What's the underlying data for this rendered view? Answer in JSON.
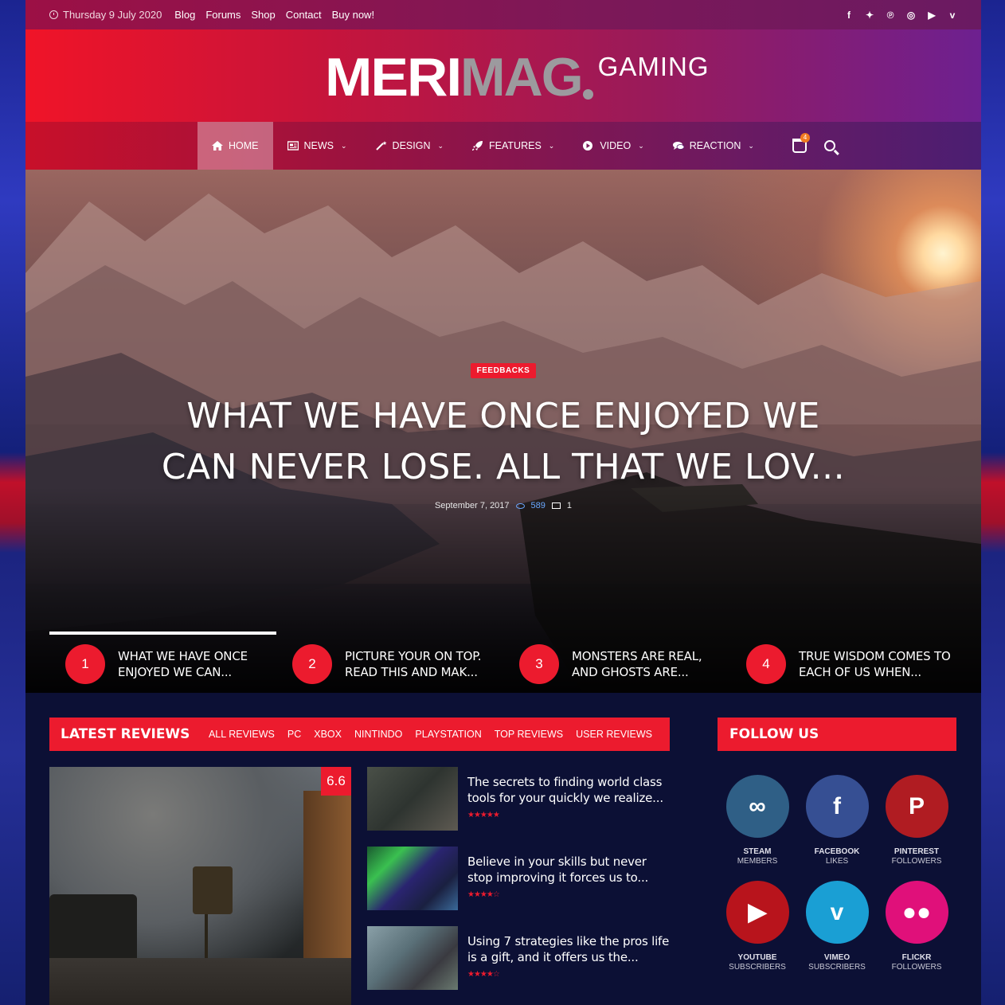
{
  "topbar": {
    "date": "Thursday 9 July 2020",
    "links": [
      "Blog",
      "Forums",
      "Shop",
      "Contact",
      "Buy now!"
    ],
    "social_icons": [
      "facebook-icon",
      "twitter-icon",
      "pinterest-icon",
      "instagram-icon",
      "youtube-icon",
      "vimeo-icon"
    ]
  },
  "logo": {
    "part1": "MERI",
    "part2": "MAG",
    "part3": "GAMING"
  },
  "nav": {
    "items": [
      {
        "label": "HOME",
        "icon": "home-icon"
      },
      {
        "label": "NEWS",
        "icon": "newspaper-icon"
      },
      {
        "label": "DESIGN",
        "icon": "wand-icon"
      },
      {
        "label": "FEATURES",
        "icon": "rocket-icon"
      },
      {
        "label": "VIDEO",
        "icon": "play-icon"
      },
      {
        "label": "REACTION",
        "icon": "chat-icon"
      }
    ],
    "cart_count": "4"
  },
  "hero": {
    "category": "FEEDBACKS",
    "title": "WHAT WE HAVE ONCE ENJOYED WE CAN NEVER LOSE. ALL THAT WE LOV...",
    "date": "September 7, 2017",
    "views": "589",
    "comments": "1"
  },
  "numbered_posts": [
    {
      "num": "1",
      "title": "WHAT WE HAVE ONCE ENJOYED WE CAN..."
    },
    {
      "num": "2",
      "title": "PICTURE YOUR ON TOP. READ THIS AND MAK..."
    },
    {
      "num": "3",
      "title": "MONSTERS ARE REAL, AND GHOSTS ARE..."
    },
    {
      "num": "4",
      "title": "TRUE WISDOM COMES TO EACH OF US WHEN..."
    }
  ],
  "reviews": {
    "title": "LATEST REVIEWS",
    "filters": [
      "ALL REVIEWS",
      "PC",
      "XBOX",
      "NINTINDO",
      "PLAYSTATION",
      "TOP REVIEWS",
      "USER REVIEWS"
    ],
    "featured_score": "6.6",
    "items": [
      {
        "title": "The secrets to finding world class tools for your quickly we realize...",
        "stars": "★★★★★"
      },
      {
        "title": "Believe in your skills but never stop improving it forces us to...",
        "stars": "★★★★☆"
      },
      {
        "title": "Using 7 strategies like the pros life is a gift, and it offers us the...",
        "stars": "★★★★☆"
      }
    ]
  },
  "follow": {
    "title": "FOLLOW US",
    "networks": [
      {
        "name": "STEAM",
        "sub": "MEMBERS",
        "color": "#2f5f86",
        "glyph": "∞"
      },
      {
        "name": "FACEBOOK",
        "sub": "LIKES",
        "color": "#364f93",
        "glyph": "f"
      },
      {
        "name": "PINTEREST",
        "sub": "FOLLOWERS",
        "color": "#b01c22",
        "glyph": "P"
      },
      {
        "name": "YOUTUBE",
        "sub": "SUBSCRIBERS",
        "color": "#b8141c",
        "glyph": "▶"
      },
      {
        "name": "VIMEO",
        "sub": "SUBSCRIBERS",
        "color": "#1a9fd4",
        "glyph": "v"
      },
      {
        "name": "FLICKR",
        "sub": "FOLLOWERS",
        "color": "#e0107a",
        "glyph": "●●"
      }
    ]
  }
}
